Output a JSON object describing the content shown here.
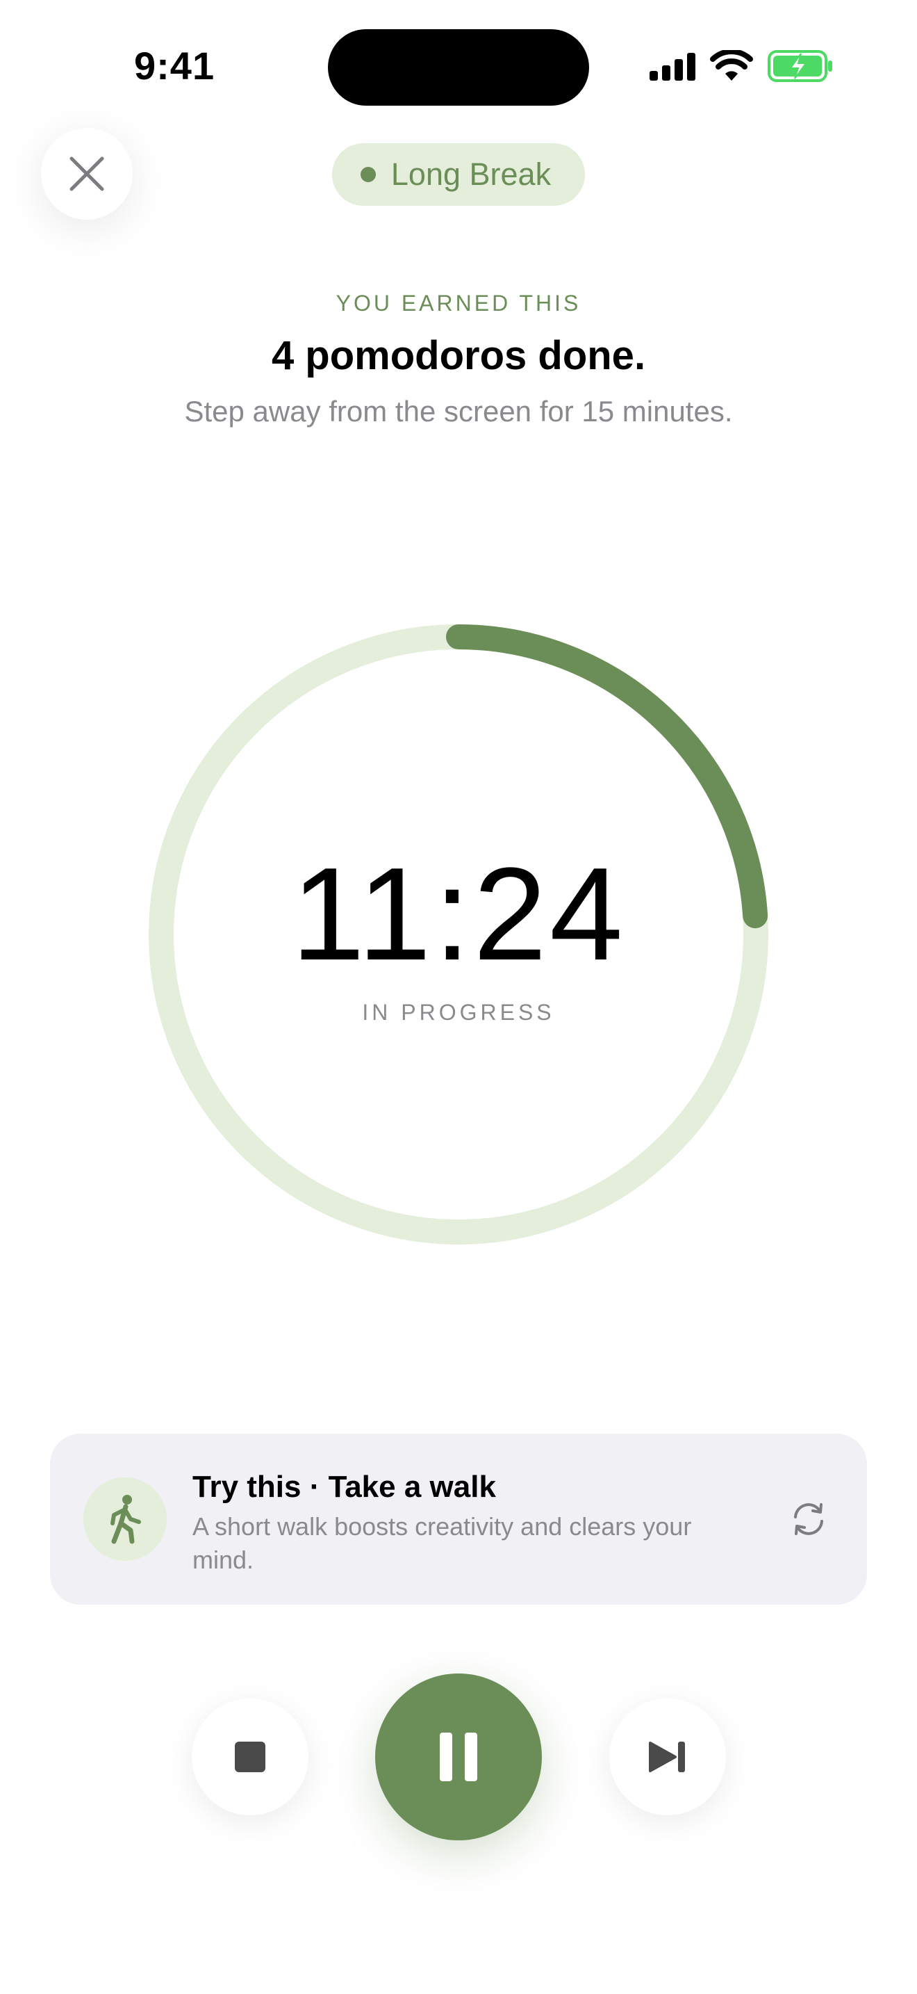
{
  "status_bar": {
    "time": "9:41",
    "icons": [
      "cellular-signal-icon",
      "wifi-icon",
      "battery-charging-icon"
    ]
  },
  "header": {
    "close_icon": "close-icon",
    "mode_label": "Long Break",
    "eyebrow": "YOU EARNED THIS",
    "headline": "4 pomodoros done.",
    "subline": "Step away from the screen for 15 minutes."
  },
  "timer": {
    "value": "11:24",
    "status": "IN PROGRESS",
    "progress_fraction": 0.24
  },
  "suggestion": {
    "icon": "walking-person-icon",
    "title": "Try this · Take a walk",
    "description": "A short walk boosts creativity and clears your mind.",
    "refresh_icon": "refresh-icon"
  },
  "controls": {
    "stop_icon": "stop-icon",
    "pause_icon": "pause-icon",
    "skip_icon": "skip-forward-icon"
  },
  "colors": {
    "accent": "#6b8e58",
    "accent_light": "#e4eedb",
    "card_bg": "#f0f0f5",
    "muted_text": "#8a8a8e",
    "battery_green": "#4cd964"
  }
}
